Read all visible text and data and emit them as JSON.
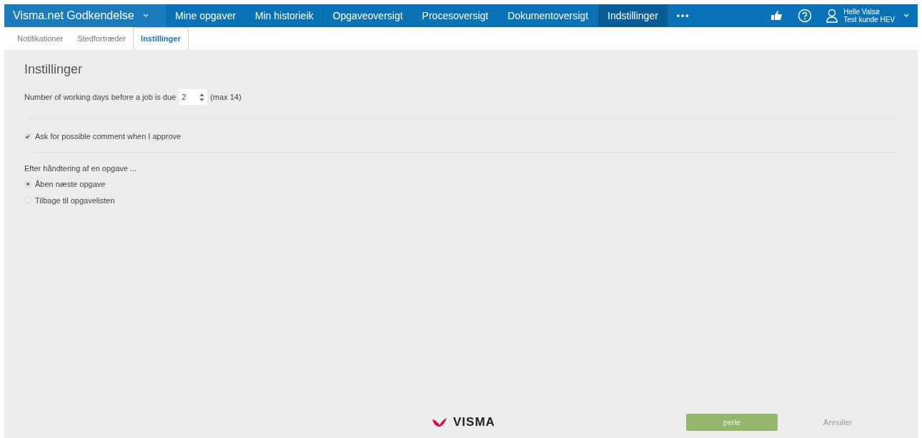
{
  "app_title": "Visma.net Godkendelse",
  "nav": [
    {
      "label": "Mine opgaver",
      "selected": false
    },
    {
      "label": "Min historieik",
      "selected": false
    },
    {
      "label": "Opgaveoversigt",
      "selected": false
    },
    {
      "label": "Procesoversigt",
      "selected": false
    },
    {
      "label": "Dokumentoversigt",
      "selected": false
    },
    {
      "label": "Indstillinger",
      "selected": true
    }
  ],
  "more": "•••",
  "user": {
    "name": "Helle Valsø",
    "company": "Test kunde HEV"
  },
  "subtabs": [
    {
      "label": "Notifikationer",
      "selected": false
    },
    {
      "label": "Stedfortræder",
      "selected": false
    },
    {
      "label": "Instillinger",
      "selected": true
    }
  ],
  "heading": "Instillinger",
  "due": {
    "label": "Number of working days before a job is due",
    "value": "2",
    "hint": "(max 14)"
  },
  "comment": {
    "label": "Ask for possible comment when I approve",
    "checked": true
  },
  "after": {
    "label": "Efter håndtering af en opgave ...",
    "options": [
      {
        "label": "Åben næste opgave",
        "selected": true
      },
      {
        "label": "Tilbage til opgavelisten",
        "selected": false
      }
    ]
  },
  "logo": "VISMA",
  "buttons": [
    {
      "label": "perle",
      "disabled": false
    },
    {
      "label": "Annuller",
      "disabled": true
    }
  ]
}
